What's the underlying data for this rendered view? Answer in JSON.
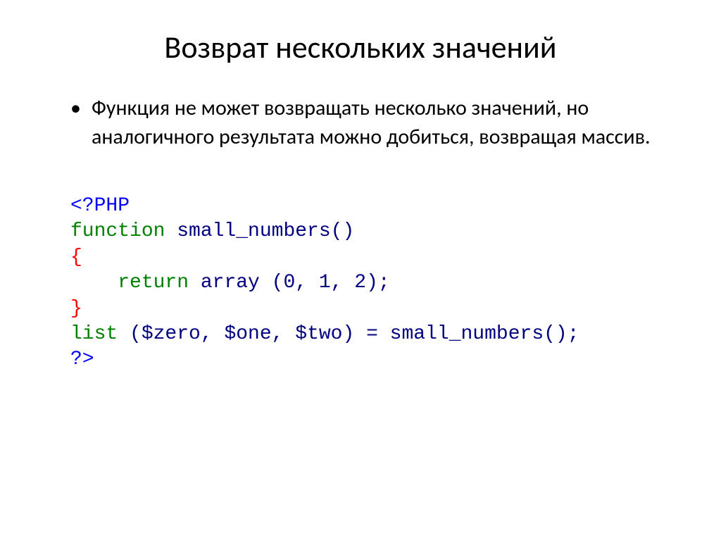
{
  "title": "Возврат нескольких значений",
  "bullet": "Функция не может возвращать несколько значений, но аналогичного результата можно добиться, возвращая массив.",
  "code": {
    "l1_open": "<?PHP",
    "l2_kw": "function",
    "l2_name": " small_numbers()",
    "l3": "{",
    "l4_indent": "    ",
    "l4_kw": "return",
    "l4_rest": " array (0, 1, 2);",
    "l5": "}",
    "l6_kw": "list",
    "l6_rest": " ($zero, $one, $two) = small_numbers();",
    "l7_close": "?>"
  }
}
